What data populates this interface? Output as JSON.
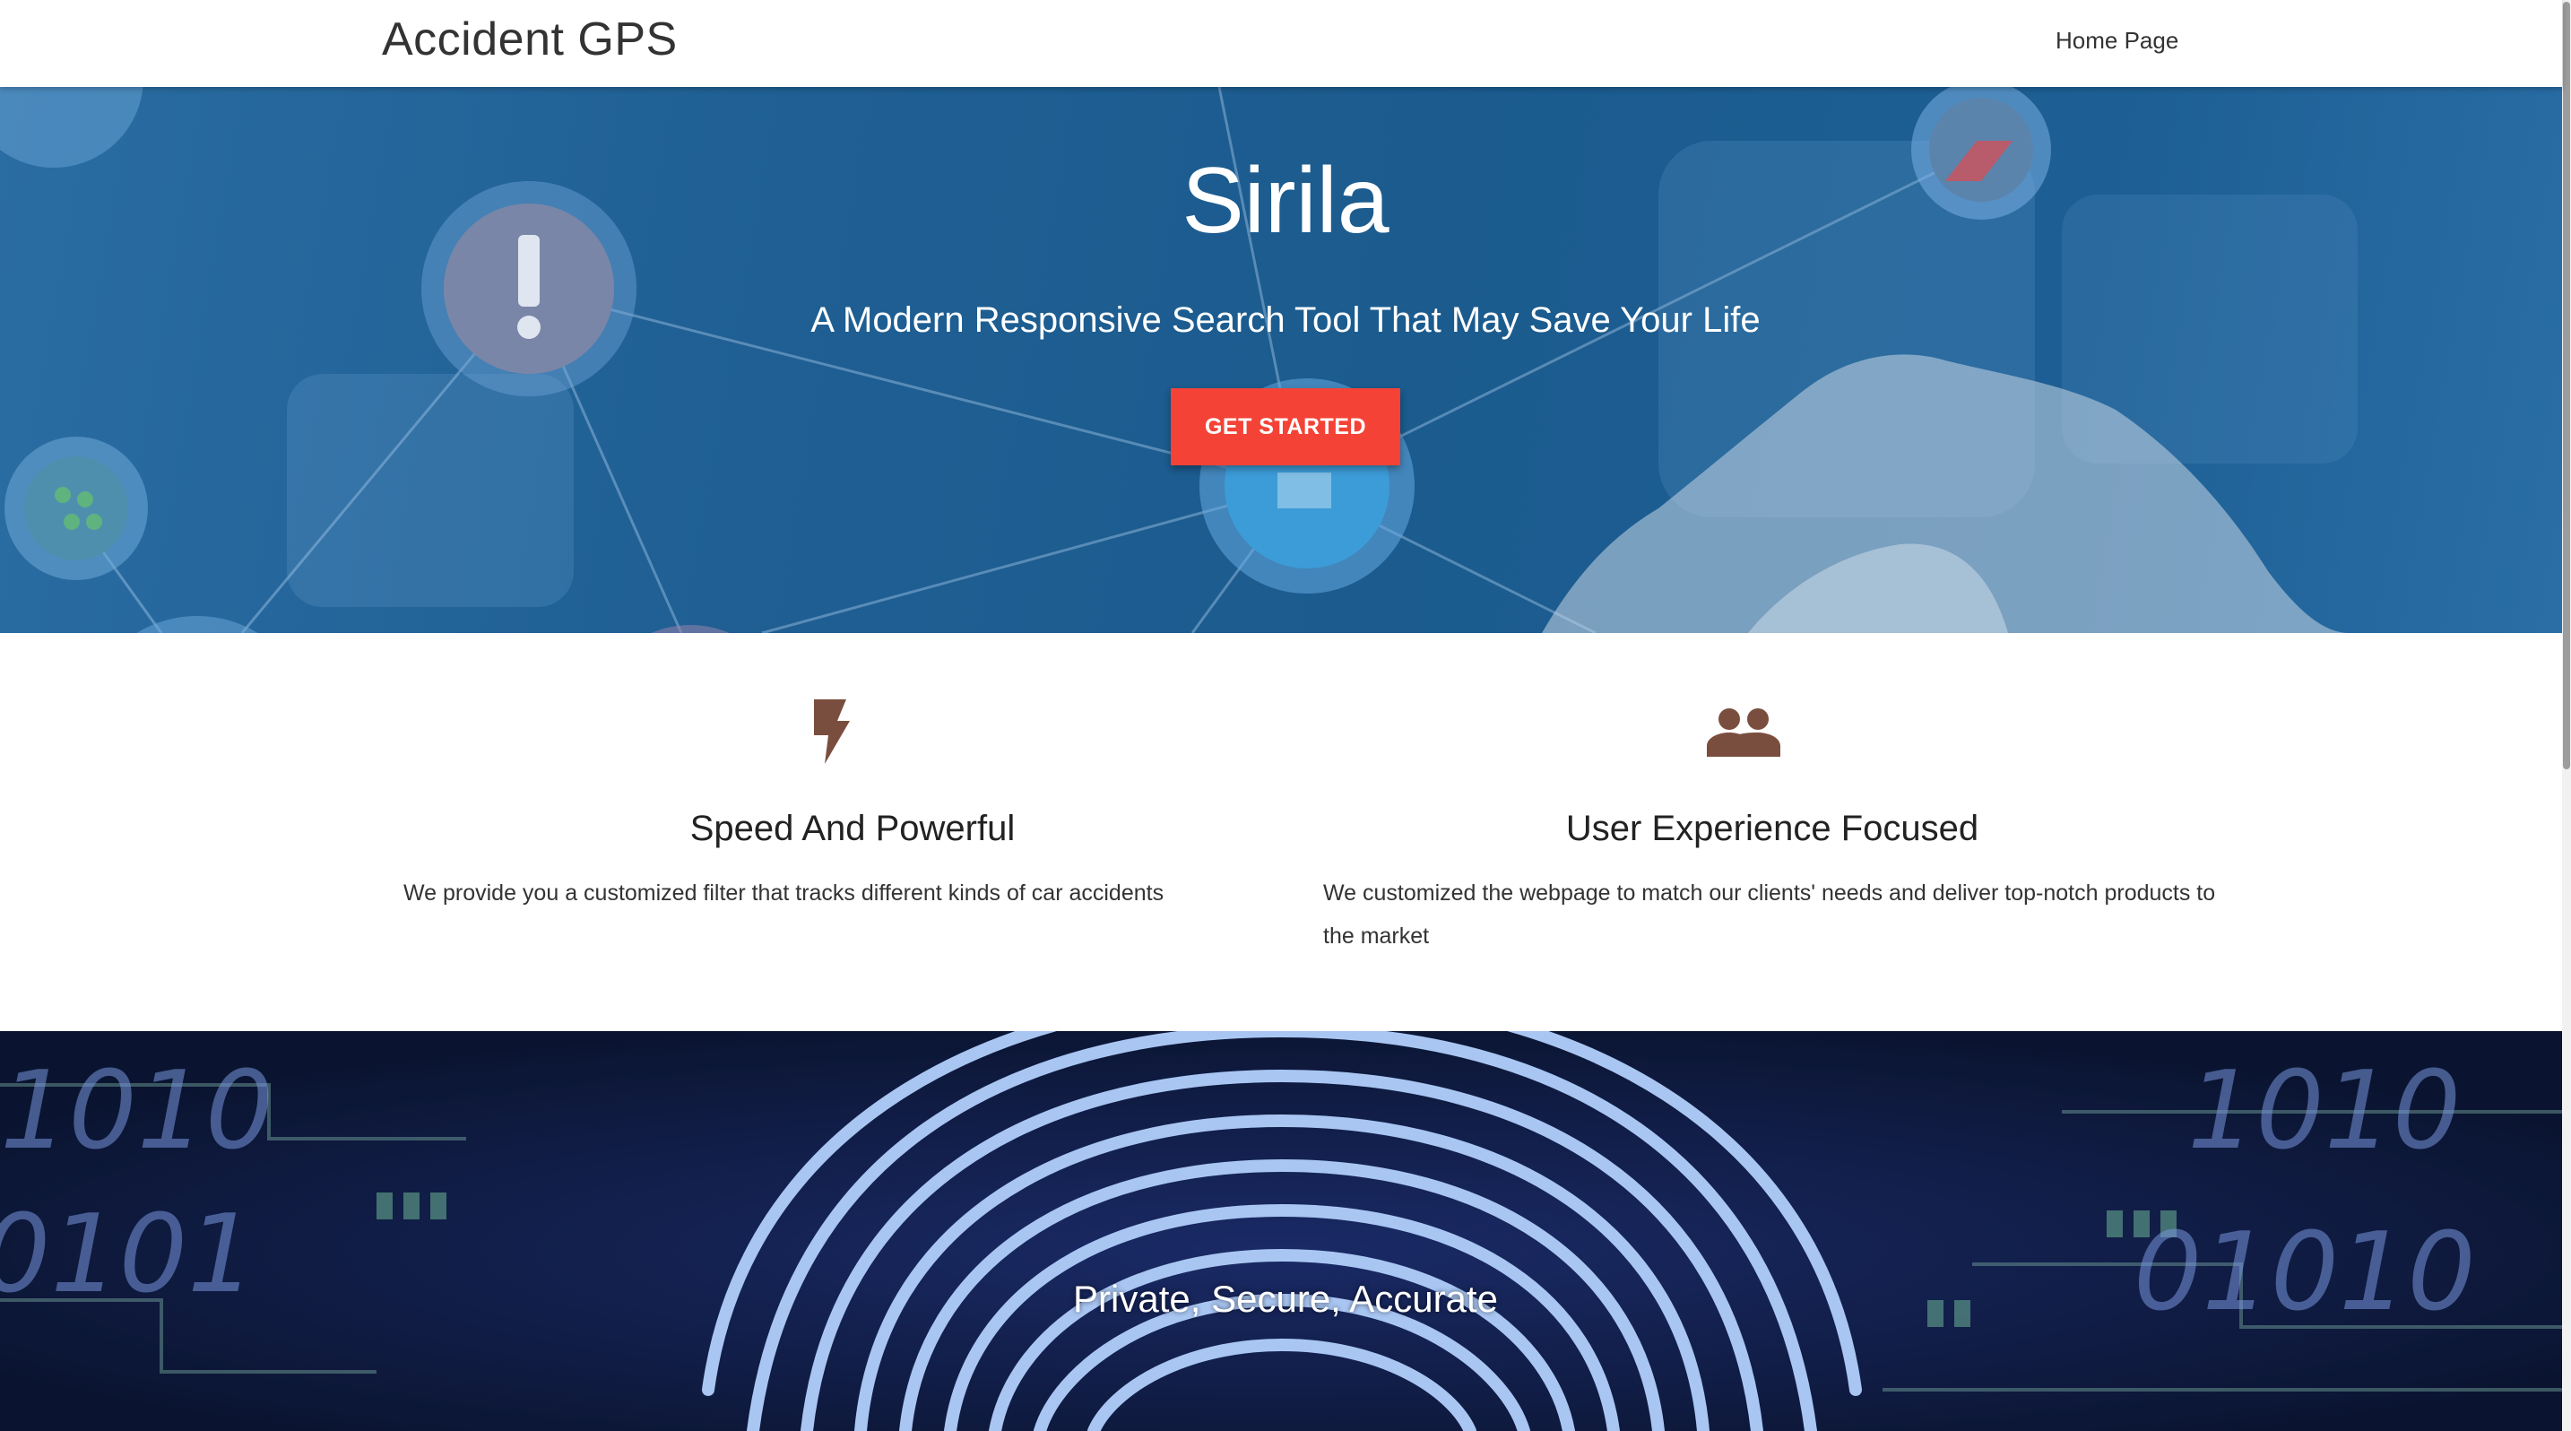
{
  "nav": {
    "brand": "Accident GPS",
    "links": [
      {
        "label": "Home Page"
      }
    ]
  },
  "hero": {
    "title": "Sirila",
    "subtitle": "A Modern Responsive Search Tool That May Save Your Life",
    "cta_label": "GET STARTED"
  },
  "features": [
    {
      "icon": "lightning-bolt-icon",
      "title": "Speed And Powerful",
      "text": "We provide you a customized filter that tracks different kinds of car accidents"
    },
    {
      "icon": "people-group-icon",
      "title": "User Experience Focused",
      "text": "We customized the webpage to match our clients' needs and deliver top-notch products to the market"
    }
  ],
  "banner": {
    "text": "Private, Secure, Accurate"
  },
  "colors": {
    "accent": "#f44336",
    "icon_brown": "#7a4e3e",
    "hero_blue": "#1f5f93"
  }
}
